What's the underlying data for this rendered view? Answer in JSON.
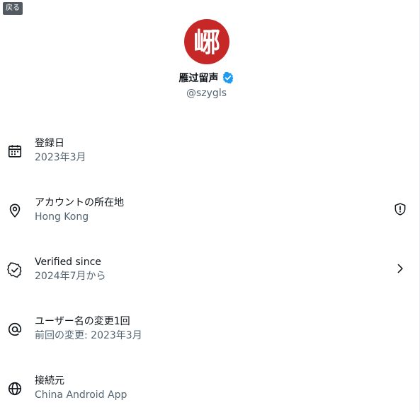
{
  "back_label": "戻る",
  "profile": {
    "avatar_glyph": "峫",
    "name": "雁过留声",
    "handle": "@szygls",
    "verified_icon": "verified-badge-icon"
  },
  "rows": [
    {
      "icon": "calendar-icon",
      "title": "登録日",
      "sub": "2023年3月"
    },
    {
      "icon": "location-pin-icon",
      "title": "アカウントの所在地",
      "sub": "Hong Kong",
      "trailing_icon": "shield-alert-icon"
    },
    {
      "icon": "verified-check-icon",
      "title": "Verified since",
      "sub": "2024年7月から",
      "trailing_icon": "chevron-right-icon"
    },
    {
      "icon": "at-sign-icon",
      "title": "ユーザー名の変更1回",
      "sub": "前回の変更: 2023年3月"
    },
    {
      "icon": "globe-icon",
      "title": "接続元",
      "sub": "China Android App"
    }
  ],
  "colors": {
    "avatar_bg": "#c62828",
    "verified_blue": "#1d9bf0",
    "primary_text": "#0f1419",
    "secondary_text": "#536471"
  }
}
